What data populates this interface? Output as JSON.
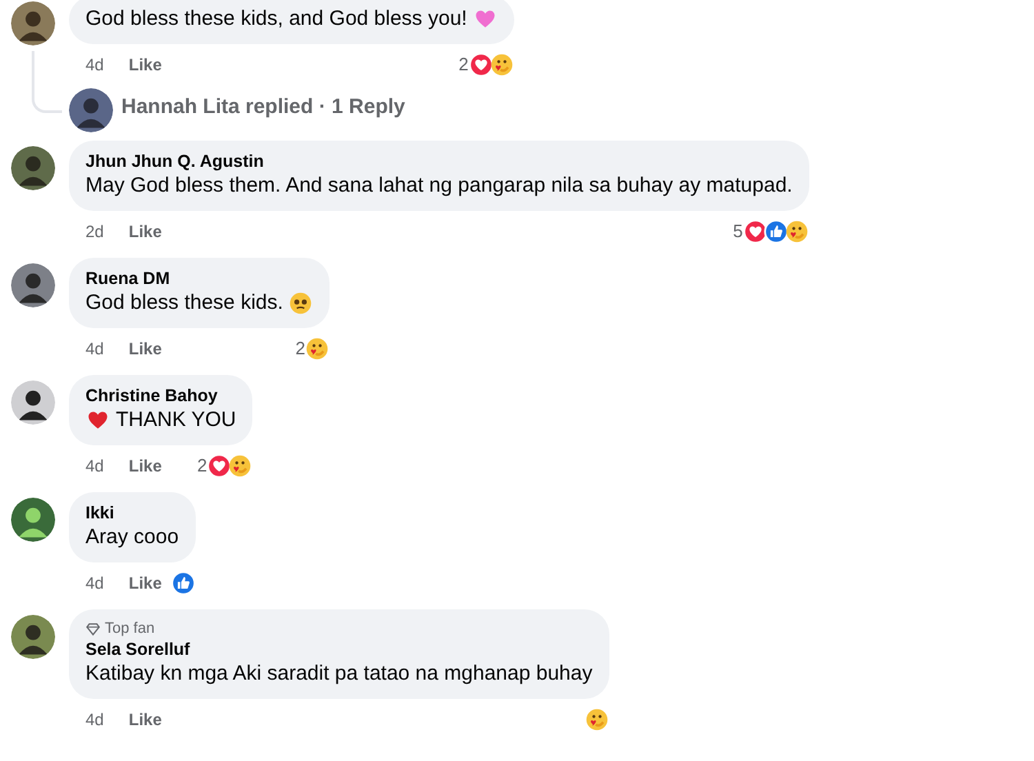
{
  "comments": [
    {
      "line": [
        {
          "kind": "text",
          "text": "God bless these kids, and God bless you!"
        },
        {
          "kind": "heart",
          "color": "#f06ed0"
        }
      ],
      "time": "4d",
      "like": "Like",
      "reactions": {
        "count": "2",
        "items": [
          {
            "kind": "love"
          },
          {
            "kind": "care"
          }
        ]
      },
      "reply": {
        "text": "Hannah Lita replied · 1 Reply"
      }
    },
    {
      "name": "Jhun Jhun Q. Agustin",
      "line": [
        {
          "kind": "text",
          "text": "May God bless them. And sana lahat ng pangarap nila sa buhay ay matupad."
        }
      ],
      "time": "2d",
      "like": "Like",
      "reactions": {
        "count": "5",
        "items": [
          {
            "kind": "love"
          },
          {
            "kind": "like"
          },
          {
            "kind": "care"
          }
        ]
      }
    },
    {
      "name": "Ruena DM",
      "line": [
        {
          "kind": "text",
          "text": "God bless these kids."
        },
        {
          "kind": "teary"
        }
      ],
      "time": "4d",
      "like": "Like",
      "reactions": {
        "count": "2",
        "items": [
          {
            "kind": "care"
          }
        ]
      }
    },
    {
      "name": "Christine Bahoy",
      "line": [
        {
          "kind": "heart",
          "color": "#e0242e"
        },
        {
          "kind": "text",
          "text": "THANK YOU"
        }
      ],
      "time": "4d",
      "like": "Like",
      "reactions": {
        "count": "2",
        "items": [
          {
            "kind": "love"
          },
          {
            "kind": "care"
          }
        ]
      }
    },
    {
      "name": "Ikki",
      "line": [
        {
          "kind": "text",
          "text": "Aray cooo"
        }
      ],
      "time": "4d",
      "like": "Like",
      "reactions": {
        "items": [
          {
            "kind": "like"
          }
        ]
      }
    },
    {
      "badge": "Top fan",
      "name": "Sela Sorelluf",
      "line": [
        {
          "kind": "text",
          "text": "Katibay kn mga Aki saradit pa tatao na mghanap buhay"
        }
      ],
      "time": "4d",
      "like": "Like",
      "reactions": {
        "items": [
          {
            "kind": "care"
          }
        ]
      }
    }
  ]
}
